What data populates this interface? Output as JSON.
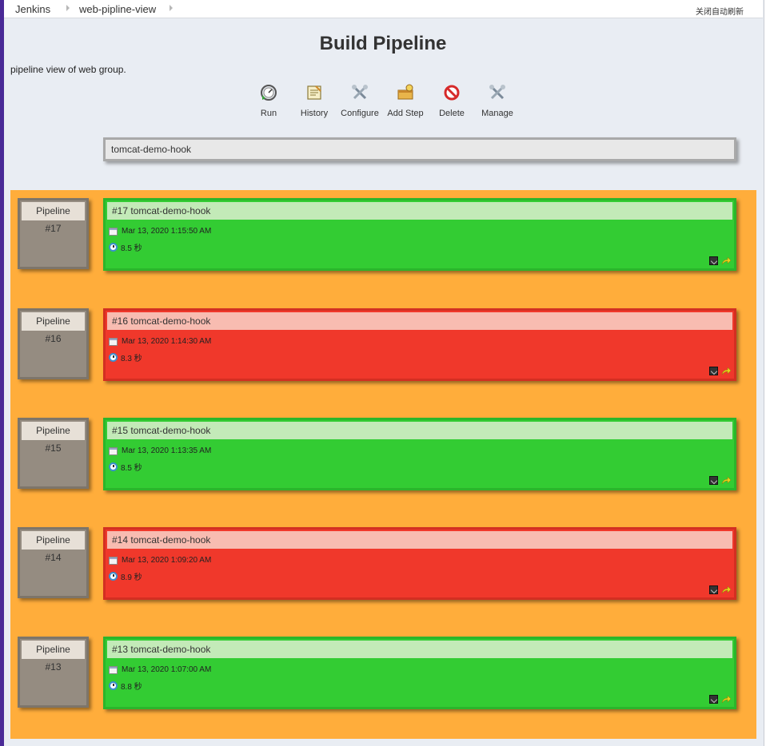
{
  "breadcrumb": {
    "items": [
      "Jenkins",
      "web-pipline-view"
    ],
    "auto_refresh": "关闭自动刷新"
  },
  "page": {
    "title": "Build Pipeline",
    "description": "pipeline view of web group."
  },
  "toolbar": {
    "run": "Run",
    "history": "History",
    "configure": "Configure",
    "add_step": "Add Step",
    "delete": "Delete",
    "manage": "Manage"
  },
  "pipeline": {
    "job_name": "tomcat-demo-hook"
  },
  "colors": {
    "success": "#33cc33",
    "failure": "#f0382b",
    "background": "#ffad3b"
  },
  "builds": [
    {
      "revision_label": "Pipeline",
      "revision_number": "#17",
      "title": "#17 tomcat-demo-hook",
      "date": "Mar 13, 2020 1:15:50 AM",
      "duration": "8.5 秒",
      "status": "success"
    },
    {
      "revision_label": "Pipeline",
      "revision_number": "#16",
      "title": "#16 tomcat-demo-hook",
      "date": "Mar 13, 2020 1:14:30 AM",
      "duration": "8.3 秒",
      "status": "failure"
    },
    {
      "revision_label": "Pipeline",
      "revision_number": "#15",
      "title": "#15 tomcat-demo-hook",
      "date": "Mar 13, 2020 1:13:35 AM",
      "duration": "8.5 秒",
      "status": "success"
    },
    {
      "revision_label": "Pipeline",
      "revision_number": "#14",
      "title": "#14 tomcat-demo-hook",
      "date": "Mar 13, 2020 1:09:20 AM",
      "duration": "8.9 秒",
      "status": "failure"
    },
    {
      "revision_label": "Pipeline",
      "revision_number": "#13",
      "title": "#13 tomcat-demo-hook",
      "date": "Mar 13, 2020 1:07:00 AM",
      "duration": "8.8 秒",
      "status": "success"
    }
  ]
}
